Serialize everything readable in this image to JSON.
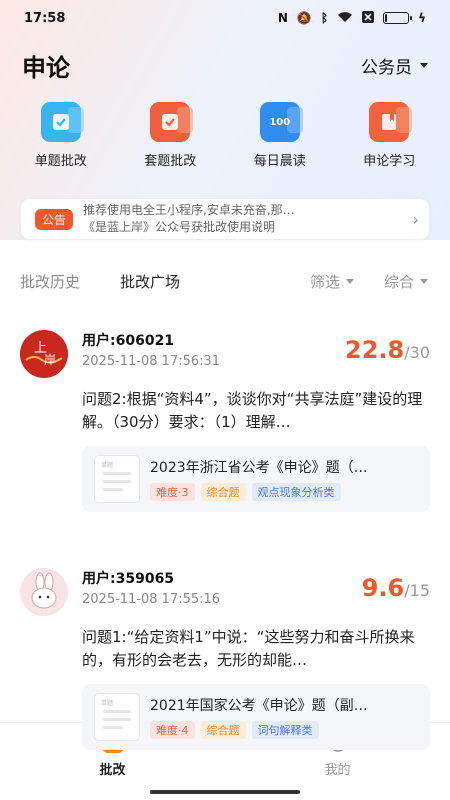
{
  "status_bar": {
    "time": "17:58",
    "icons": [
      "nfc-icon",
      "mute-icon",
      "bluetooth-icon",
      "wifi-icon",
      "no-sim-icon",
      "battery-icon",
      "charging-icon"
    ],
    "battery_level": 0.1
  },
  "header": {
    "title": "申论",
    "role": "公务员"
  },
  "entries": [
    {
      "label": "单题批改",
      "icon": "single-grading-icon",
      "color": "#37b5f2",
      "color2": "#7fd0f7"
    },
    {
      "label": "套题批改",
      "icon": "set-grading-icon",
      "color": "#f0603c",
      "color2": "#f79a82"
    },
    {
      "label": "每日晨读",
      "icon": "morning-read-icon",
      "color": "#2f8cf0",
      "color2": "#7bb6f6",
      "badge": "100"
    },
    {
      "label": "申论学习",
      "icon": "study-book-icon",
      "color": "#f2623c",
      "color2": "#f39a7a"
    }
  ],
  "notice": {
    "badge": "公告",
    "line1": "推荐使用电全王小程序,安卓未充奋,那…",
    "line2": "《是蓝上岸》公众号获批改使用说明"
  },
  "tabs": {
    "history": "批改历史",
    "square": "批改广场",
    "filter": "筛选",
    "sort": "综合"
  },
  "posts": [
    {
      "user": "用户:606021",
      "time": "2025-11-08 17:56:31",
      "score": "22.8",
      "total": "/30",
      "question": "问题2:根据“资料4”，谈谈你对“共享法庭”建设的理解。（30分）要求：（1）理解…",
      "paper_title": "2023年浙江省公考《申论》题（…",
      "thumb_label": "单题",
      "tags": [
        "难度·3",
        "综合题",
        "观点现象分析类"
      ]
    },
    {
      "user": "用户:359065",
      "time": "2025-11-08 17:55:16",
      "score": "9.6",
      "total": "/15",
      "question": "问题1:“给定资料1”中说：“这些努力和奋斗所换来的，有形的会老去，无形的却能…",
      "paper_title": "2021年国家公考《申论》题（副…",
      "thumb_label": "单题",
      "tags": [
        "难度·4",
        "综合题",
        "词句解释类"
      ]
    }
  ],
  "bottom_nav": {
    "grading": "批改",
    "mine": "我的"
  },
  "colors": {
    "accent": "#f0582b",
    "nav_active": "#f08c1c"
  }
}
